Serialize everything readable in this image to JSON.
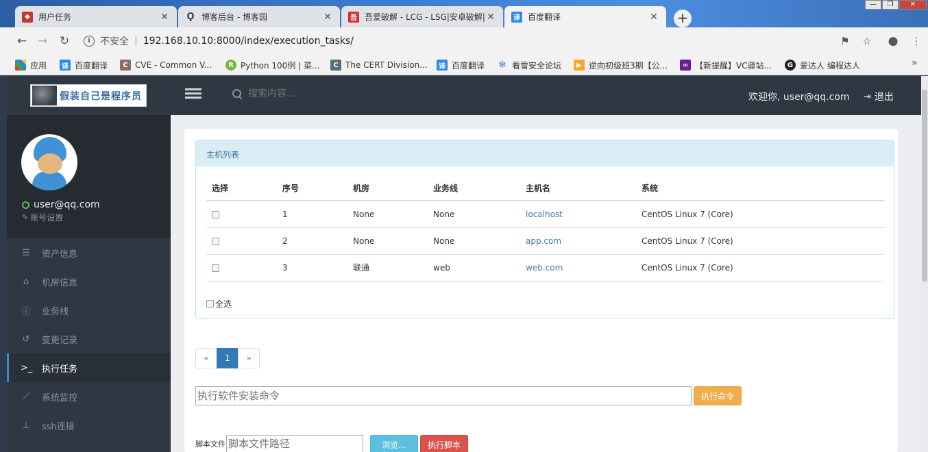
{
  "browser": {
    "tabs": [
      {
        "title": "用户任务",
        "favicon_color": "#c0392b",
        "active": false
      },
      {
        "title": "博客后台 - 博客园",
        "favicon_color": "#555555",
        "active": false
      },
      {
        "title": "吾爱破解 - LCG - LSG|安卓破解|",
        "favicon_color": "#d32f2f",
        "active": false
      },
      {
        "title": "百度翻译",
        "favicon_color": "#2e8ae6",
        "active": true
      }
    ],
    "new_tab": "+",
    "address": {
      "insecure_label": "不安全",
      "url": "192.168.10.10:8000/index/execution_tasks/"
    },
    "bookmarks": [
      {
        "label": "应用",
        "icon": "apps-grid-icon"
      },
      {
        "label": "百度翻译",
        "icon": "translate-icon"
      },
      {
        "label": "CVE - Common V...",
        "icon": "cve-icon"
      },
      {
        "label": "Python 100例 | 菜...",
        "icon": "runoob-icon"
      },
      {
        "label": "The CERT Division...",
        "icon": "cert-icon"
      },
      {
        "label": "百度翻译",
        "icon": "translate-icon"
      },
      {
        "label": "看雪安全论坛",
        "icon": "snowflake-icon"
      },
      {
        "label": "逆向初级班3期【公...",
        "icon": "flag-icon"
      },
      {
        "label": "【新提醒】VC驿站...",
        "icon": "vs-icon"
      },
      {
        "label": "爱达人 编程达人",
        "icon": "aida-icon"
      }
    ],
    "bookmarks_more": "»"
  },
  "header": {
    "brand": "假装自己是程序员",
    "search_placeholder": "搜索内容...",
    "welcome": "欢迎你, user@qq.com",
    "logout": "退出"
  },
  "sidebar": {
    "user": "user@qq.com",
    "account_settings": "账号设置",
    "items": [
      {
        "label": "资产信息",
        "icon": "server-icon"
      },
      {
        "label": "机房信息",
        "icon": "home-icon"
      },
      {
        "label": "业务线",
        "icon": "info-icon"
      },
      {
        "label": "变更记录",
        "icon": "history-icon"
      },
      {
        "label": "执行任务",
        "icon": "terminal-icon"
      },
      {
        "label": "系统监控",
        "icon": "chart-icon"
      },
      {
        "label": "ssh连接",
        "icon": "sitemap-icon"
      }
    ],
    "active_index": 4
  },
  "hosts_panel": {
    "title": "主机列表",
    "columns": [
      "选择",
      "序号",
      "机房",
      "业务线",
      "主机名",
      "系统"
    ],
    "rows": [
      {
        "id": "1",
        "room": "None",
        "line": "None",
        "host": "localhost",
        "os": "CentOS Linux 7 (Core)"
      },
      {
        "id": "2",
        "room": "None",
        "line": "None",
        "host": "app.com",
        "os": "CentOS Linux 7 (Core)"
      },
      {
        "id": "3",
        "room": "联通",
        "line": "web",
        "host": "web.com",
        "os": "CentOS Linux 7 (Core)"
      }
    ],
    "select_all": "全选"
  },
  "pagination": {
    "prev": "«",
    "current": "1",
    "next": "»"
  },
  "command": {
    "placeholder": "执行软件安装命令",
    "exec_button": "执行命令"
  },
  "script": {
    "label": "脚本文件",
    "placeholder": "脚本文件路径",
    "browse_button": "浏览...",
    "run_button": "执行脚本"
  },
  "colors": {
    "accent": "#337ab7",
    "panel_head": "#d9edf7",
    "exec_btn": "#f0ad4e",
    "browse_btn": "#5bc0de",
    "run_btn": "#d9534f",
    "sidebar": "#2f3742"
  }
}
